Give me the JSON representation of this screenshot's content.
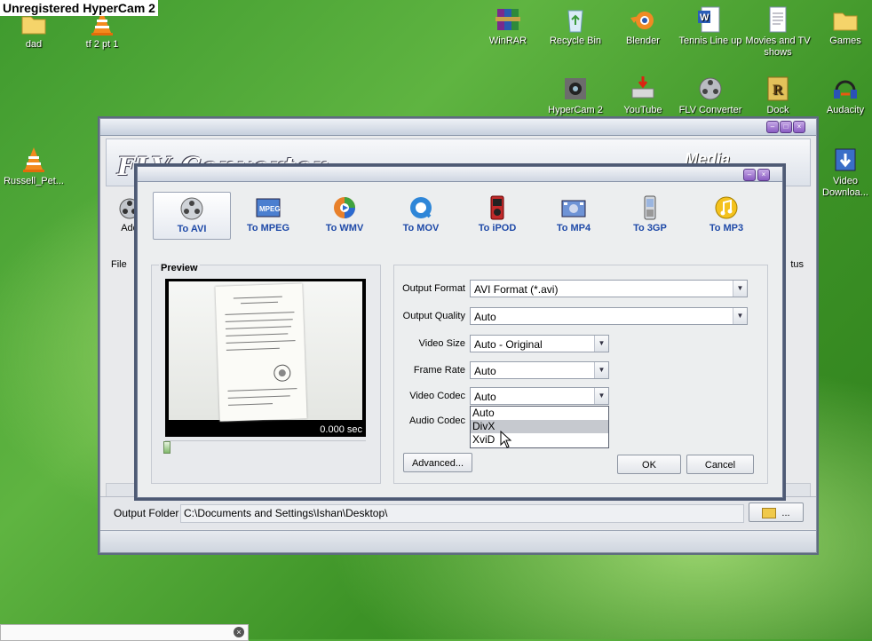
{
  "watermark": "Unregistered HyperCam 2",
  "desktop_icons": {
    "dad": "dad",
    "tf2": "tf 2 pt 1",
    "russell": "Russell_Pet...",
    "winrar": "WinRAR",
    "recycle": "Recycle Bin",
    "blender": "Blender",
    "tennis": "Tennis Line up",
    "movies": "Movies and TV shows",
    "games": "Games",
    "hypercam": "HyperCam 2",
    "youtube": "YouTube",
    "flv": "FLV Converter",
    "dock": "Dock",
    "audacity": "Audacity",
    "video_dl": "Video Downloa..."
  },
  "back_window": {
    "logo": "FLV Converter",
    "media": "Media",
    "add_label": "Add",
    "menu_file": "File",
    "status_col": "tus",
    "output_folder_label": "Output Folder",
    "output_folder_value": "C:\\Documents and Settings\\Ishan\\Desktop\\",
    "browse_label": "..."
  },
  "dialog": {
    "tabs": [
      {
        "label": "To AVI"
      },
      {
        "label": "To MPEG"
      },
      {
        "label": "To WMV"
      },
      {
        "label": "To MOV"
      },
      {
        "label": "To iPOD"
      },
      {
        "label": "To MP4"
      },
      {
        "label": "To 3GP"
      },
      {
        "label": "To MP3"
      }
    ],
    "preview": {
      "title": "Preview",
      "time": "0.000 sec"
    },
    "settings": {
      "output_format": {
        "label": "Output Format",
        "value": "AVI Format (*.avi)"
      },
      "output_quality": {
        "label": "Output Quality",
        "value": "Auto"
      },
      "video_size": {
        "label": "Video Size",
        "value": "Auto - Original"
      },
      "frame_rate": {
        "label": "Frame Rate",
        "value": "Auto"
      },
      "video_codec": {
        "label": "Video Codec",
        "value": "Auto"
      },
      "audio_codec": {
        "label": "Audio Codec"
      }
    },
    "codec_options": [
      "Auto",
      "DivX",
      "XviD"
    ],
    "advanced_label": "Advanced...",
    "ok_label": "OK",
    "cancel_label": "Cancel"
  }
}
